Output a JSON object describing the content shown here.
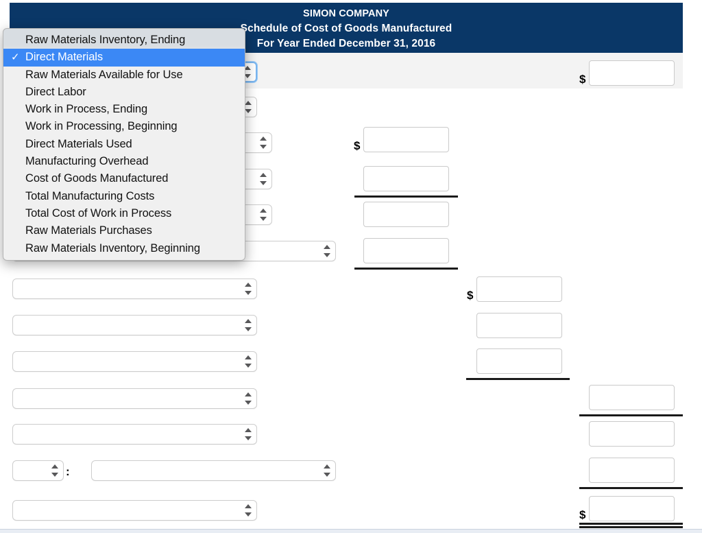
{
  "statement": {
    "company": "SIMON COMPANY",
    "title": "Schedule of Cost of Goods Manufactured",
    "period": "For Year Ended December 31, 2016"
  },
  "colors": {
    "header_bg": "#0a3767",
    "selection_blue": "#3b88f5",
    "row_stripe": "#f3f3f3",
    "rule": "#1a1a1a"
  },
  "dropdown": {
    "open": true,
    "selected": "Direct Materials",
    "check_glyph": "✓",
    "items": [
      {
        "label": "Raw Materials Inventory, Ending",
        "selected": false
      },
      {
        "label": "Direct Materials",
        "selected": true
      },
      {
        "label": "Raw Materials Available for Use",
        "selected": false
      },
      {
        "label": "Direct Labor",
        "selected": false
      },
      {
        "label": "Work in Process, Ending",
        "selected": false
      },
      {
        "label": "Work in Processing, Beginning",
        "selected": false
      },
      {
        "label": "Direct Materials Used",
        "selected": false
      },
      {
        "label": "Manufacturing Overhead",
        "selected": false
      },
      {
        "label": "Cost of Goods Manufactured",
        "selected": false
      },
      {
        "label": "Total Manufacturing Costs",
        "selected": false
      },
      {
        "label": "Total Cost of Work in Process",
        "selected": false
      },
      {
        "label": "Raw Materials Purchases",
        "selected": false
      },
      {
        "label": "Raw Materials Inventory, Beginning",
        "selected": false
      }
    ]
  },
  "symbols": {
    "dollar": "$",
    "colon": ":",
    "stepper_up": "▲",
    "stepper_down": "▼"
  },
  "rows": [
    {
      "id": "row-1",
      "select_value": "",
      "amount_value": "",
      "dollar": true
    },
    {
      "id": "row-2",
      "select_value": "",
      "amount_value": "",
      "dollar": false
    },
    {
      "id": "row-3",
      "select_value": "",
      "amount_value": "",
      "dollar": true
    },
    {
      "id": "row-4",
      "select_value": "",
      "amount_value": "",
      "dollar": false
    },
    {
      "id": "row-5",
      "select_value": "",
      "amount_value": "",
      "dollar": false
    },
    {
      "id": "row-6",
      "select_value": "",
      "amount_value": "",
      "dollar": false
    },
    {
      "id": "row-7",
      "select_value": "",
      "amount_value": "",
      "dollar": true
    },
    {
      "id": "row-8",
      "select_value": "",
      "amount_value": "",
      "dollar": false
    },
    {
      "id": "row-9",
      "select_value": "",
      "amount_value": "",
      "dollar": false
    },
    {
      "id": "row-10",
      "select_value": "",
      "amount_value": "",
      "dollar": false
    },
    {
      "id": "row-11",
      "select_value": "",
      "amount_value": "",
      "dollar": false
    },
    {
      "id": "row-12",
      "select_value": "",
      "select_value_2": "",
      "amount_value": "",
      "dollar": false
    },
    {
      "id": "row-13",
      "select_value": "",
      "amount_value": "",
      "dollar": true
    }
  ]
}
